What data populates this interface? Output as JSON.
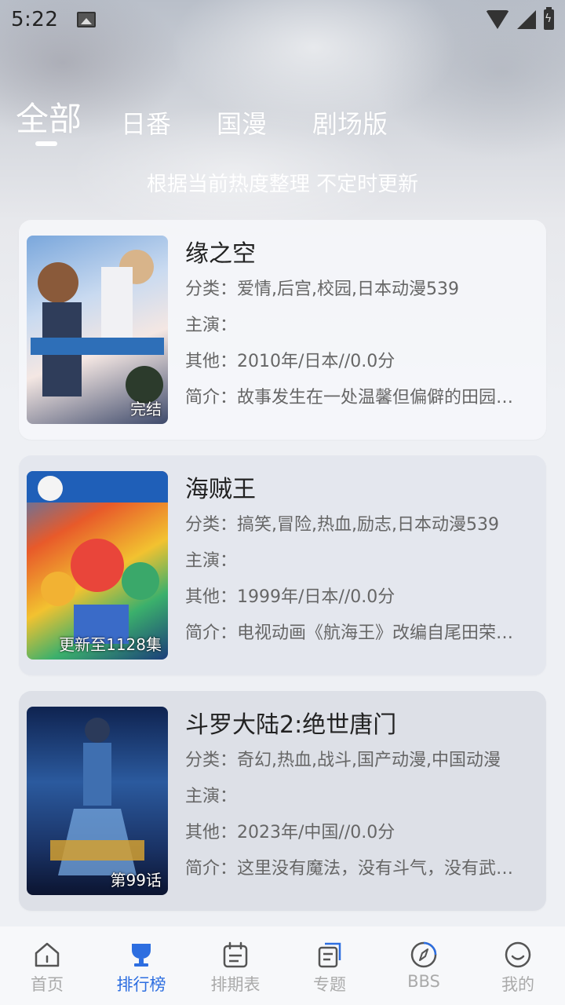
{
  "status_bar": {
    "time": "5:22"
  },
  "tabs": [
    {
      "label": "全部",
      "active": true
    },
    {
      "label": "日番",
      "active": false
    },
    {
      "label": "国漫",
      "active": false
    },
    {
      "label": "剧场版",
      "active": false
    }
  ],
  "subtitle": "根据当前热度整理 不定时更新",
  "items": [
    {
      "title": "缘之空",
      "status": "完结",
      "category": "分类：爱情,后宫,校园,日本动漫539",
      "cast": "主演：",
      "other": "其他：2010年/日本//0.0分",
      "intro": "简介：故事发生在一处温馨但偏僻的田园…"
    },
    {
      "title": "海贼王",
      "status": "更新至1128集",
      "category": "分类：搞笑,冒险,热血,励志,日本动漫539",
      "cast": "主演：",
      "other": "其他：1999年/日本//0.0分",
      "intro": "简介：电视动画《航海王》改编自尾田荣…"
    },
    {
      "title": "斗罗大陆2:绝世唐门",
      "status": "第99话",
      "category": "分类：奇幻,热血,战斗,国产动漫,中国动漫",
      "cast": "主演：",
      "other": "其他：2023年/中国//0.0分",
      "intro": "简介：这里没有魔法，没有斗气，没有武…"
    }
  ],
  "nav": [
    {
      "label": "首页",
      "icon": "home-icon",
      "active": false
    },
    {
      "label": "排行榜",
      "icon": "trophy-icon",
      "active": true
    },
    {
      "label": "排期表",
      "icon": "calendar-icon",
      "active": false
    },
    {
      "label": "专题",
      "icon": "topic-icon",
      "active": false
    },
    {
      "label": "BBS",
      "icon": "compass-icon",
      "active": false
    },
    {
      "label": "我的",
      "icon": "smile-icon",
      "active": false
    }
  ],
  "colors": {
    "accent": "#2d6ee0",
    "inactive": "#aaaaaa"
  }
}
